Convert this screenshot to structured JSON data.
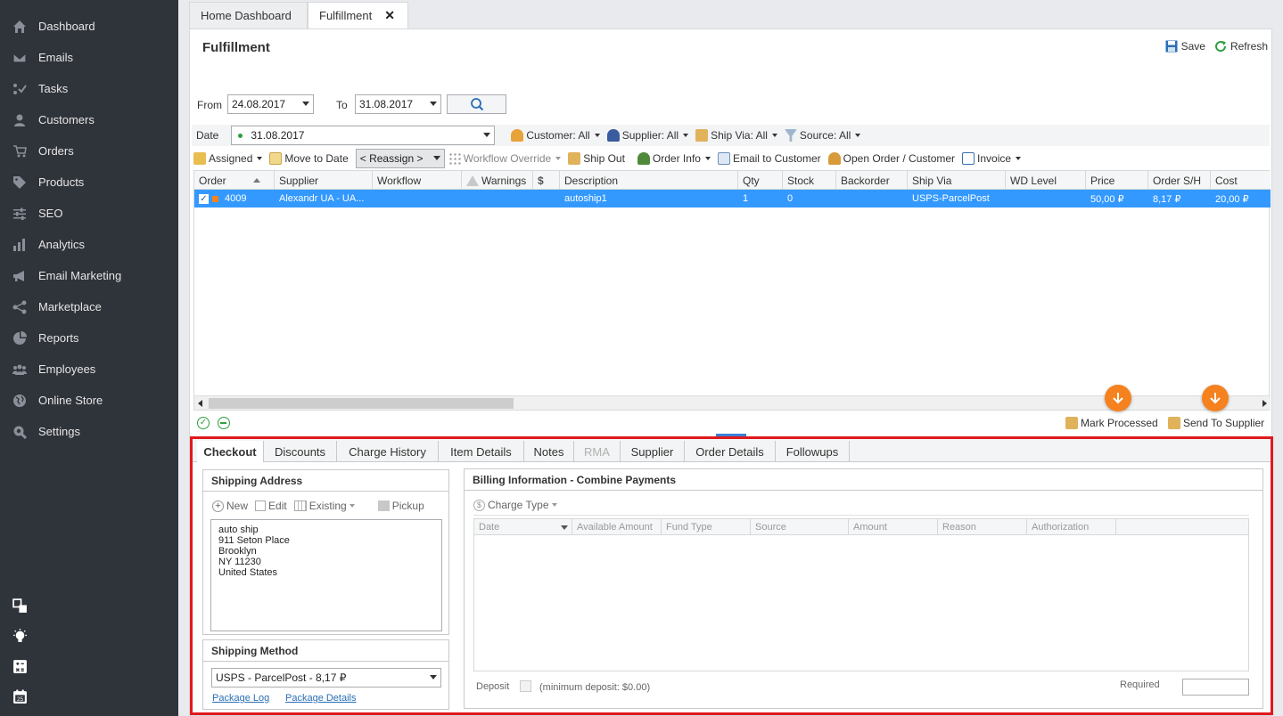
{
  "sidebar": {
    "items": [
      {
        "label": "Dashboard",
        "icon": "home-icon"
      },
      {
        "label": "Emails",
        "icon": "envelope-icon"
      },
      {
        "label": "Tasks",
        "icon": "tasks-icon"
      },
      {
        "label": "Customers",
        "icon": "user-icon"
      },
      {
        "label": "Orders",
        "icon": "cart-icon"
      },
      {
        "label": "Products",
        "icon": "tag-icon"
      },
      {
        "label": "SEO",
        "icon": "sliders-icon"
      },
      {
        "label": "Analytics",
        "icon": "bar-chart-icon"
      },
      {
        "label": "Email Marketing",
        "icon": "megaphone-icon"
      },
      {
        "label": "Marketplace",
        "icon": "share-icon"
      },
      {
        "label": "Reports",
        "icon": "pie-chart-icon"
      },
      {
        "label": "Employees",
        "icon": "users-icon"
      },
      {
        "label": "Online Store",
        "icon": "globe-icon"
      },
      {
        "label": "Settings",
        "icon": "wrench-icon"
      }
    ]
  },
  "tabs": {
    "home": "Home Dashboard",
    "fulfillment": "Fulfillment"
  },
  "page": {
    "title": "Fulfillment",
    "save": "Save",
    "refresh": "Refresh"
  },
  "filters": {
    "from_label": "From",
    "from_value": "24.08.2017",
    "to_label": "To",
    "to_value": "31.08.2017",
    "date_label": "Date",
    "date_value": "31.08.2017",
    "customer": "Customer: All",
    "supplier": "Supplier: All",
    "ship_via": "Ship Via: All",
    "source": "Source: All"
  },
  "toolbar": {
    "assigned": "Assigned",
    "move_to_date": "Move to Date",
    "reassign": "< Reassign >",
    "workflow_override": "Workflow Override",
    "ship_out": "Ship Out",
    "order_info": "Order Info",
    "email_customer": "Email to Customer",
    "open_order": "Open Order / Customer",
    "invoice": "Invoice"
  },
  "grid": {
    "columns": [
      "Order",
      "Supplier",
      "Workflow",
      "Warnings",
      "$",
      "Description",
      "Qty",
      "Stock",
      "Backorder",
      "Ship Via",
      "WD Level",
      "Price",
      "Order S/H",
      "Cost"
    ],
    "row": {
      "order": "4009",
      "supplier": "Alexandr UA - UA...",
      "description": "autoship1",
      "qty": "1",
      "stock": "0",
      "ship_via": "USPS-ParcelPost",
      "price": "50,00 ₽",
      "order_sh": "8,17 ₽",
      "cost": "20,00 ₽"
    }
  },
  "actions": {
    "mark_processed": "Mark Processed",
    "send_to_supplier": "Send To Supplier"
  },
  "detail_tabs": [
    "Checkout",
    "Discounts",
    "Charge History",
    "Item Details",
    "Notes",
    "RMA",
    "Supplier",
    "Order Details",
    "Followups"
  ],
  "shipping": {
    "title": "Shipping Address",
    "new": "New",
    "edit": "Edit",
    "existing": "Existing",
    "pickup": "Pickup",
    "address_lines": [
      "auto ship",
      "911 Seton Place",
      "Brooklyn",
      "NY 11230",
      "United States"
    ],
    "method_title": "Shipping Method",
    "method_value": "USPS - ParcelPost - 8,17 ₽",
    "package_log": "Package Log",
    "package_details": "Package Details"
  },
  "billing": {
    "title": "Billing Information - Combine Payments",
    "charge_type": "Charge Type",
    "columns": [
      "Date",
      "Available Amount",
      "Fund Type",
      "Source",
      "Amount",
      "Reason",
      "Authorization"
    ],
    "deposit": "Deposit",
    "min_deposit": "(minimum deposit: $0.00)",
    "required": "Required"
  }
}
